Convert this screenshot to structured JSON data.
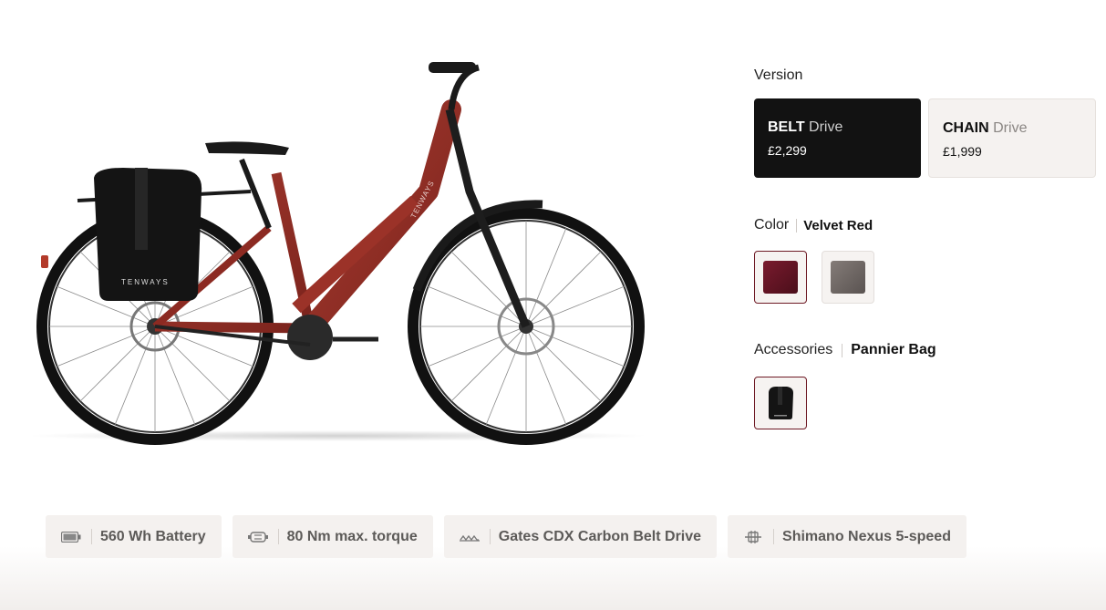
{
  "version": {
    "label": "Version",
    "options": [
      {
        "brand": "BELT",
        "type": "Drive",
        "price": "£2,299",
        "selected": true
      },
      {
        "brand": "CHAIN",
        "type": "Drive",
        "price": "£1,999",
        "selected": false
      }
    ]
  },
  "color": {
    "label": "Color",
    "selected": "Velvet Red",
    "swatches": [
      {
        "name": "velvet-red",
        "hex": "#5e1424",
        "selected": true
      },
      {
        "name": "grey",
        "hex": "#6d6663",
        "selected": false
      }
    ]
  },
  "accessories": {
    "label": "Accessories",
    "selected": "Pannier Bag"
  },
  "product": {
    "frame_text": "TENWAYS",
    "bag_text": "TENWAYS"
  },
  "features": [
    {
      "icon": "battery-icon",
      "label": "560 Wh Battery"
    },
    {
      "icon": "motor-icon",
      "label": "80 Nm max. torque"
    },
    {
      "icon": "belt-icon",
      "label": "Gates CDX Carbon Belt Drive"
    },
    {
      "icon": "gear-hub-icon",
      "label": "Shimano Nexus 5-speed"
    }
  ]
}
